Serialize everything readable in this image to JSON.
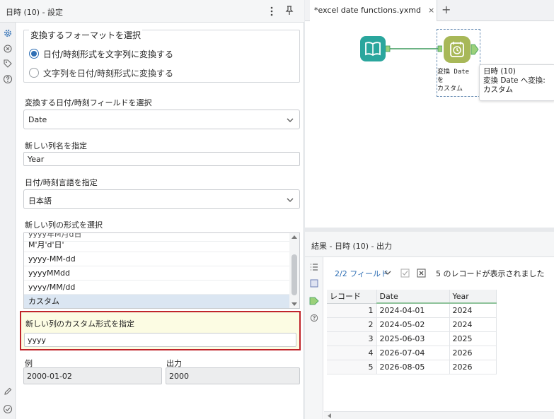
{
  "config_panel": {
    "title": "日時 (10)",
    "title_suffix": " - 設定",
    "format_group": {
      "legend": "変換するフォーマットを選択",
      "options": [
        {
          "label": "日付/時刻形式を文字列に変換する",
          "selected": true
        },
        {
          "label": "文字列を日付/時刻形式に変換する",
          "selected": false
        }
      ]
    },
    "field_select": {
      "label": "変換する日付/時刻フィールドを選択",
      "value": "Date"
    },
    "new_column": {
      "label": "新しい列名を指定",
      "value": "Year"
    },
    "language": {
      "label": "日付/時刻言語を指定",
      "value": "日本語"
    },
    "format_list": {
      "label": "新しい列の形式を選択",
      "items": [
        "yyyy年M月d日",
        "M'月'd'日'",
        "yyyy-MM-dd",
        "yyyyMMdd",
        "yyyy/MM/dd",
        "カスタム"
      ],
      "selected": "カスタム"
    },
    "custom_format": {
      "label": "新しい列のカスタム形式を指定",
      "value": "yyyy"
    },
    "example": {
      "label": "例",
      "value": "2000-01-02"
    },
    "output": {
      "label": "出力",
      "value": "2000"
    }
  },
  "canvas": {
    "tab_label": "*excel date functions.yxmd",
    "tab_close": "×",
    "tab_add": "+",
    "tool_caption": [
      "変換 Date",
      "を",
      "カスタム"
    ],
    "tooltip": [
      "日時 (10)",
      "変換 Date へ変換:",
      "カスタム"
    ]
  },
  "results": {
    "title": "結果 - 日時 (10) - 出力",
    "field_selector": "2/2 フィールド",
    "records_message": "5 のレコードが表示されました",
    "columns": [
      "レコード",
      "Date",
      "Year"
    ],
    "rows": [
      [
        "1",
        "2024-04-01",
        "2024"
      ],
      [
        "2",
        "2024-05-02",
        "2024"
      ],
      [
        "3",
        "2025-06-03",
        "2025"
      ],
      [
        "4",
        "2026-07-04",
        "2026"
      ],
      [
        "5",
        "2026-08-05",
        "2026"
      ]
    ]
  },
  "colors": {
    "accent": "#2f6fb5",
    "highlight_border": "#c0242b",
    "highlight_bg": "#fcfce3",
    "input_tool": "#2aa69d",
    "datetime_tool": "#a8b858"
  }
}
